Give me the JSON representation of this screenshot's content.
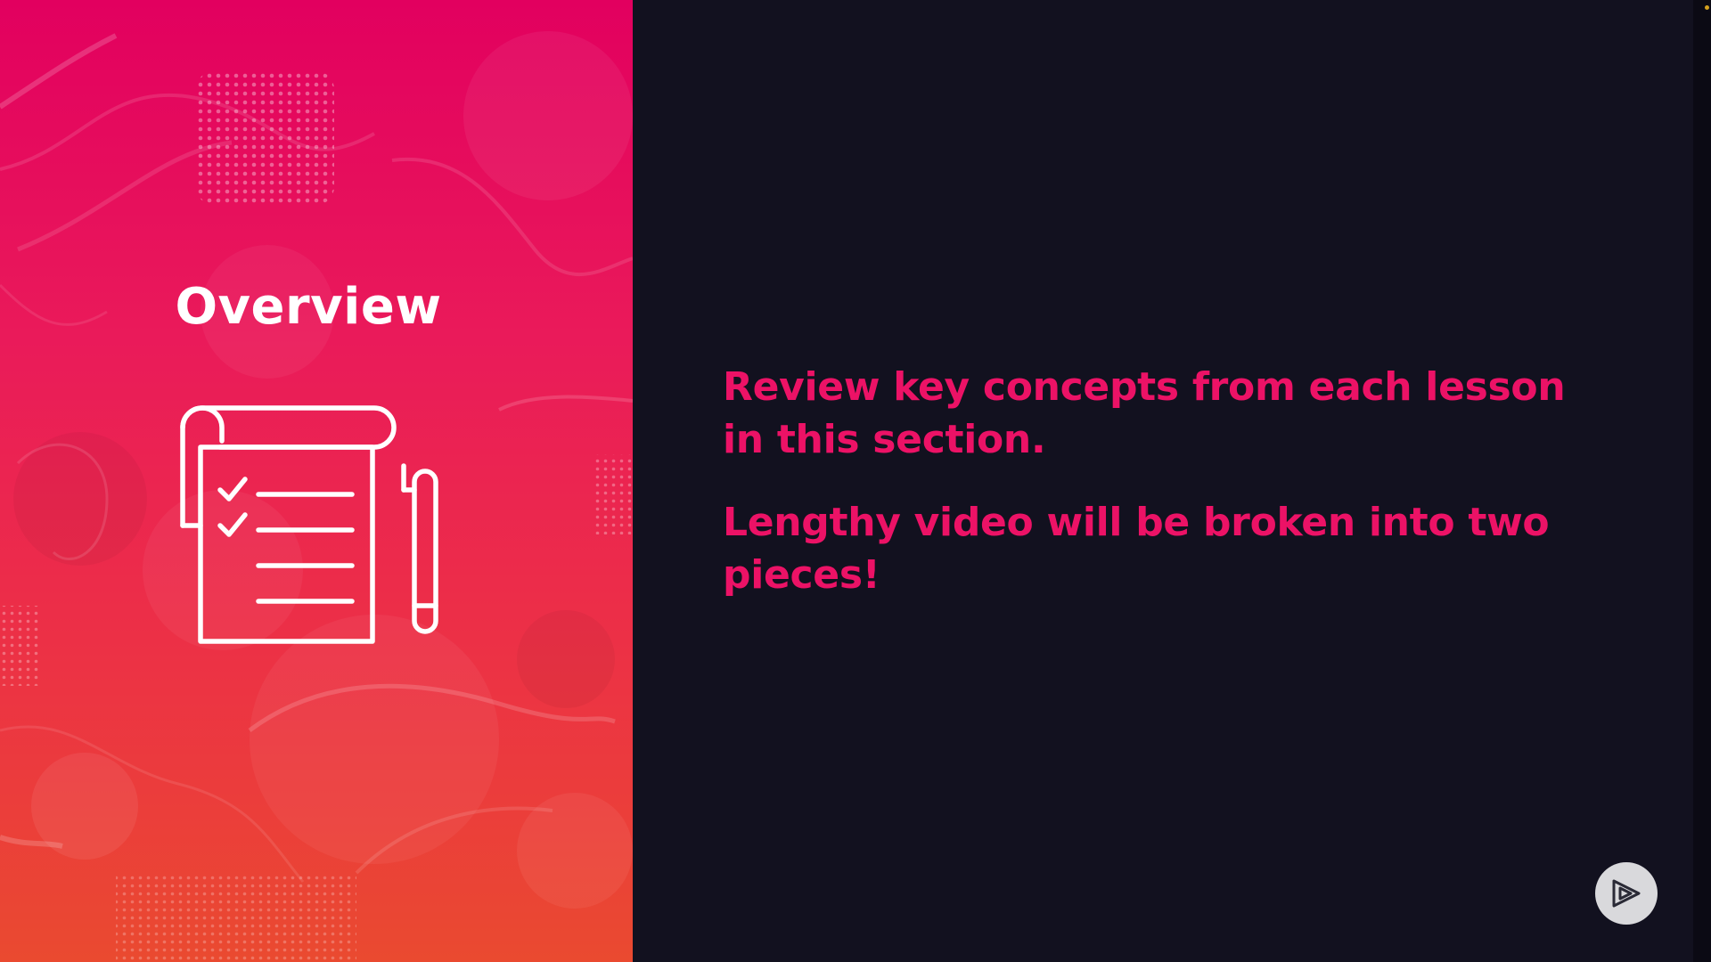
{
  "slide": {
    "title": "Overview",
    "bullets": [
      "Review key concepts from each lesson in this section.",
      "Lengthy video will be broken into two pieces!"
    ]
  },
  "icons": {
    "main_illustration": "checklist-notepad-with-pen-icon",
    "player_button": "pluralsight-play-icon"
  },
  "colors": {
    "accent": "#ec1266",
    "background": "#12111f",
    "panel_gradient_top": "#e2005f",
    "panel_gradient_bottom": "#ea4a30",
    "title_text": "#ffffff"
  }
}
